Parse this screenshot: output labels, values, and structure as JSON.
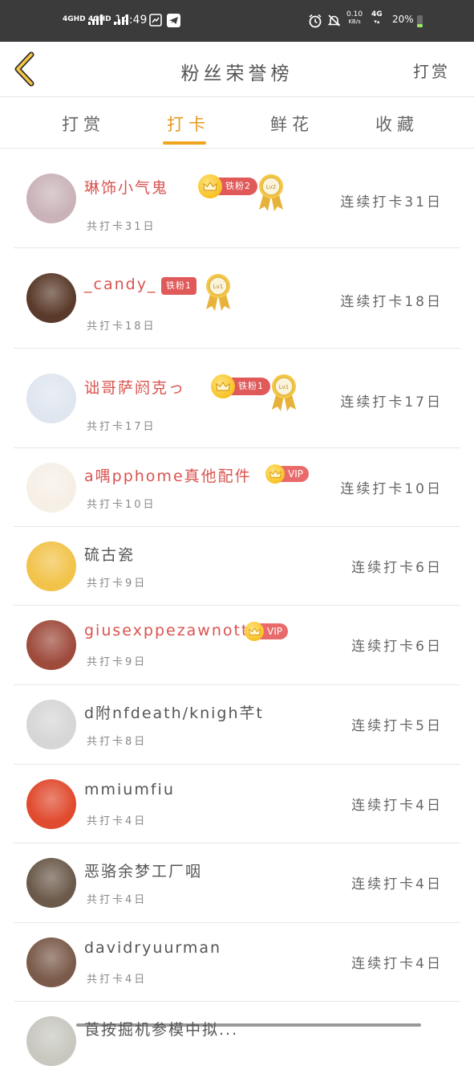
{
  "status": {
    "net1": "4GHD",
    "net2": "4GHD",
    "time": "14:49",
    "speed_top": "0.10",
    "speed_unit": "KB/s",
    "net3": "4G",
    "battery": "20%"
  },
  "header": {
    "title": "粉丝荣誉榜",
    "right_link": "打赏"
  },
  "tabs": [
    {
      "label": "打赏",
      "active": false
    },
    {
      "label": "打卡",
      "active": true
    },
    {
      "label": "鲜花",
      "active": false
    },
    {
      "label": "收藏",
      "active": false
    }
  ],
  "rows": [
    {
      "name": "琳饰小气鬼",
      "total": "共打卡31日",
      "streak": "连续打卡31日",
      "fan": "铁粉2",
      "medal": "Lv2",
      "vip": "",
      "avatar_color": "#c9b3b8"
    },
    {
      "name": "_candy_",
      "total": "共打卡18日",
      "streak": "连续打卡18日",
      "fan": "铁粉1",
      "medal": "Lv1",
      "vip": "",
      "avatar_color": "#5a3a2a"
    },
    {
      "name": "诎哥萨阏克っ",
      "total": "共打卡17日",
      "streak": "连续打卡17日",
      "fan": "铁粉1",
      "medal": "Lv1",
      "vip": "",
      "avatar_color": "#dfe6ef"
    },
    {
      "name": "a喁pphome真他配件",
      "total": "共打卡10日",
      "streak": "连续打卡10日",
      "fan": "",
      "medal": "",
      "vip": "VIP",
      "avatar_color": "#f6efe6"
    },
    {
      "name": "硫古瓷",
      "total": "共打卡9日",
      "streak": "连续打卡6日",
      "fan": "",
      "medal": "",
      "vip": "",
      "avatar_color": "#f2c34a"
    },
    {
      "name": "giusexppezawnotti",
      "total": "共打卡9日",
      "streak": "连续打卡6日",
      "fan": "",
      "medal": "",
      "vip": "VIP",
      "avatar_color": "#9e4b3c"
    },
    {
      "name": "d附nfdeath/knigh芊t",
      "total": "共打卡8日",
      "streak": "连续打卡5日",
      "fan": "",
      "medal": "",
      "vip": "",
      "avatar_color": "#d6d6d6"
    },
    {
      "name": "mmiumfiu",
      "total": "共打卡4日",
      "streak": "连续打卡4日",
      "fan": "",
      "medal": "",
      "vip": "",
      "avatar_color": "#e04a2e"
    },
    {
      "name": "恶骆余梦工厂咽",
      "total": "共打卡4日",
      "streak": "连续打卡4日",
      "fan": "",
      "medal": "",
      "vip": "",
      "avatar_color": "#6b5a4a"
    },
    {
      "name": "davidryuurman",
      "total": "共打卡4日",
      "streak": "连续打卡4日",
      "fan": "",
      "medal": "",
      "vip": "",
      "avatar_color": "#7a5a4a"
    },
    {
      "name": "莨按掘机参模中拟...",
      "total": "",
      "streak": "",
      "fan": "",
      "medal": "",
      "vip": "",
      "avatar_color": "#c8c8c0"
    }
  ]
}
